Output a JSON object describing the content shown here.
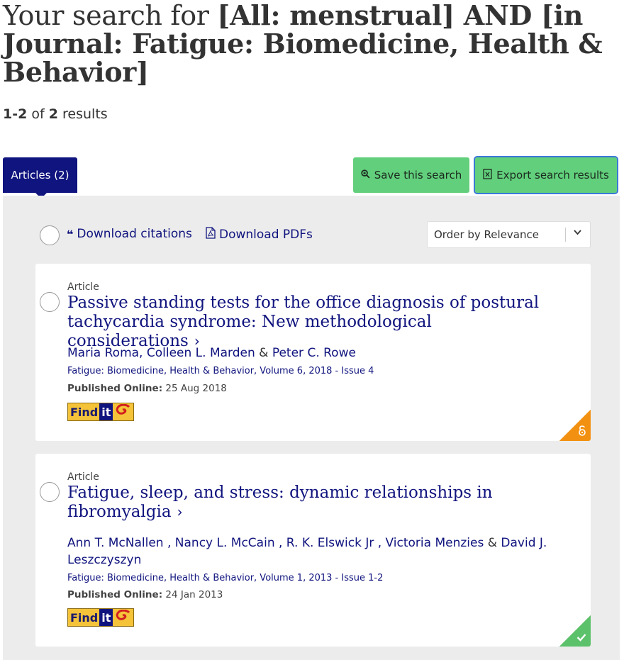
{
  "search": {
    "prefix": "Your search for ",
    "query": "[All: menstrual] AND [in Journal: Fatigue: Biomedicine, Health & Behavior]"
  },
  "results": {
    "range": "1-2",
    "of": "of",
    "total": "2",
    "suffix": "results"
  },
  "tabs": {
    "articles_label": "Articles (2)"
  },
  "actions": {
    "save_label": "Save this search",
    "export_label": "Export search results"
  },
  "toolbar": {
    "download_citations": "Download citations",
    "download_pdfs": "Download PDFs",
    "order_by": "Order by Relevance"
  },
  "articles": [
    {
      "type": "Article",
      "title": "Passive standing tests for the office diagnosis of postural tachycardia syndrome: New methodological considerations",
      "authors": "Maria Roma, Colleen L. Marden",
      "authors_amp": "&",
      "authors_last": "Peter C. Rowe",
      "journal": "Fatigue: Biomedicine, Health & Behavior, Volume 6, 2018 - Issue 4",
      "published_label": "Published Online:",
      "published_date": "25 Aug 2018",
      "access": "open-access"
    },
    {
      "type": "Article",
      "title": "Fatigue, sleep, and stress: dynamic relationships in fibromyalgia",
      "authors": "Ann T. McNallen , Nancy L. McCain , R. K. Elswick Jr , Victoria Menzies",
      "authors_amp": "&",
      "authors_last": "David J. Leszczyszyn",
      "journal": "Fatigue: Biomedicine, Health & Behavior, Volume 1, 2013 - Issue 1-2",
      "published_label": "Published Online:",
      "published_date": "24 Jan 2013",
      "access": "full-access"
    }
  ],
  "findit": {
    "find": "Find",
    "it": "it"
  },
  "colors": {
    "navy": "#10147e",
    "green": "#62cf7c",
    "orange": "#f29111",
    "panel": "#ececec"
  },
  "icons": {
    "save": "search-save-icon",
    "export": "export-file-icon",
    "citations": "quote-icon",
    "pdf": "pdf-icon",
    "select": "chevron-down-icon",
    "title_arrow": "chevron-right-icon",
    "open_access": "unlock-icon",
    "full_access": "checkmark-icon"
  }
}
